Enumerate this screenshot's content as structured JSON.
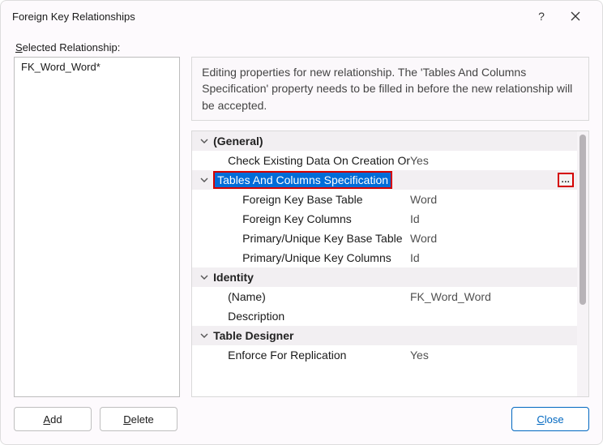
{
  "window": {
    "title": "Foreign Key Relationships"
  },
  "header": {
    "label_pre": "S",
    "label_rest": "elected Relationship:"
  },
  "list": {
    "items": [
      {
        "text": "FK_Word_Word*"
      }
    ]
  },
  "description": "Editing properties for new relationship.  The 'Tables And Columns Specification' property needs to be filled in before the new relationship will be accepted.",
  "grid": {
    "general": {
      "label": "(General)",
      "check_label": "Check Existing Data On Creation Or",
      "check_value": "Yes",
      "tcs": {
        "label": "Tables And Columns Specification",
        "fk_base_label": "Foreign Key Base Table",
        "fk_base_value": "Word",
        "fk_cols_label": "Foreign Key Columns",
        "fk_cols_value": "Id",
        "pk_base_label": "Primary/Unique Key Base Table",
        "pk_base_value": "Word",
        "pk_cols_label": "Primary/Unique Key Columns",
        "pk_cols_value": "Id",
        "ellipsis": "..."
      }
    },
    "identity": {
      "label": "Identity",
      "name_label": "(Name)",
      "name_value": "FK_Word_Word",
      "desc_label": "Description",
      "desc_value": ""
    },
    "designer": {
      "label": "Table Designer",
      "enforce_label": "Enforce For Replication",
      "enforce_value": "Yes"
    }
  },
  "buttons": {
    "add_ak": "A",
    "add_rest": "dd",
    "del_ak": "D",
    "del_rest": "elete",
    "close_ak": "C",
    "close_rest": "lose"
  }
}
